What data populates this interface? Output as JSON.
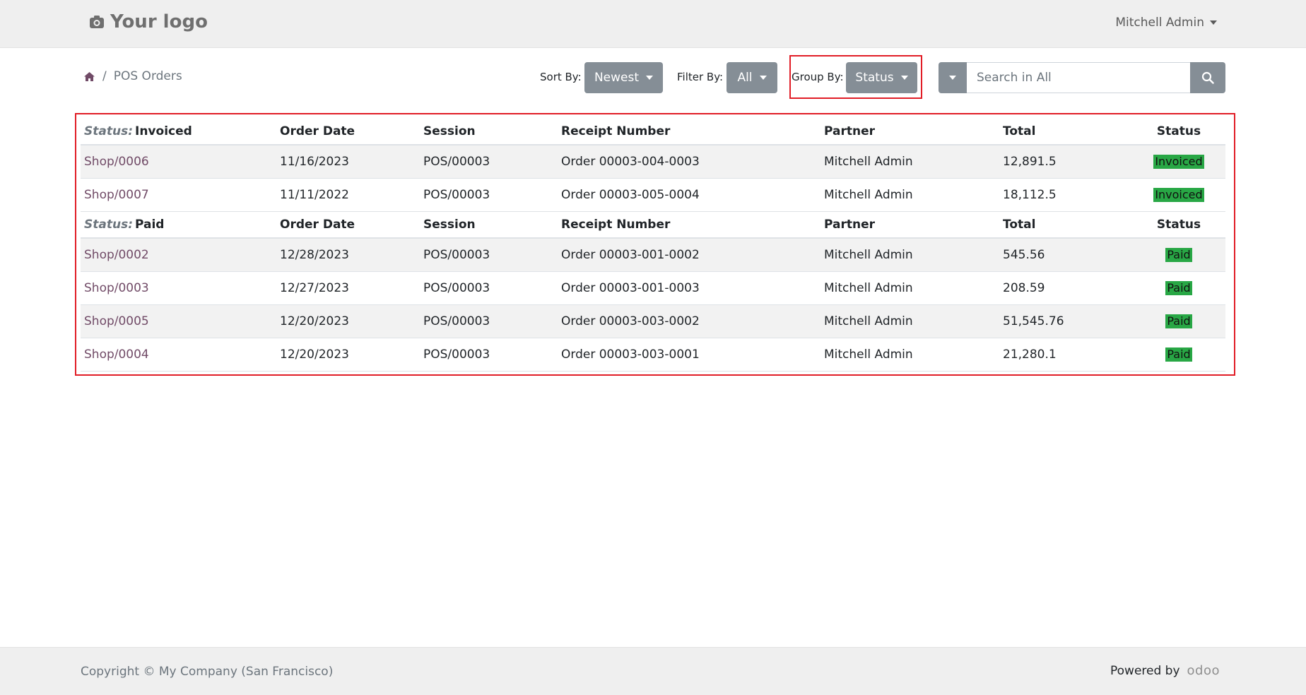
{
  "header": {
    "logo_text": "Your logo",
    "user_name": "Mitchell Admin"
  },
  "breadcrumb": {
    "current": "POS Orders"
  },
  "controls": {
    "sort_label": "Sort By:",
    "sort_value": "Newest",
    "filter_label": "Filter By:",
    "filter_value": "All",
    "group_label": "Group By:",
    "group_value": "Status",
    "search_placeholder": "Search in All"
  },
  "table": {
    "group_prefix": "Status:",
    "columns": [
      "Order Date",
      "Session",
      "Receipt Number",
      "Partner",
      "Total",
      "Status"
    ],
    "groups": [
      {
        "name": "Invoiced",
        "rows": [
          {
            "order": "Shop/0006",
            "date": "11/16/2023",
            "session": "POS/00003",
            "receipt": "Order 00003-004-0003",
            "partner": "Mitchell Admin",
            "total": "12,891.5",
            "status": "Invoiced"
          },
          {
            "order": "Shop/0007",
            "date": "11/11/2022",
            "session": "POS/00003",
            "receipt": "Order 00003-005-0004",
            "partner": "Mitchell Admin",
            "total": "18,112.5",
            "status": "Invoiced"
          }
        ]
      },
      {
        "name": "Paid",
        "rows": [
          {
            "order": "Shop/0002",
            "date": "12/28/2023",
            "session": "POS/00003",
            "receipt": "Order 00003-001-0002",
            "partner": "Mitchell Admin",
            "total": "545.56",
            "status": "Paid"
          },
          {
            "order": "Shop/0003",
            "date": "12/27/2023",
            "session": "POS/00003",
            "receipt": "Order 00003-001-0003",
            "partner": "Mitchell Admin",
            "total": "208.59",
            "status": "Paid"
          },
          {
            "order": "Shop/0005",
            "date": "12/20/2023",
            "session": "POS/00003",
            "receipt": "Order 00003-003-0002",
            "partner": "Mitchell Admin",
            "total": "51,545.76",
            "status": "Paid"
          },
          {
            "order": "Shop/0004",
            "date": "12/20/2023",
            "session": "POS/00003",
            "receipt": "Order 00003-003-0001",
            "partner": "Mitchell Admin",
            "total": "21,280.1",
            "status": "Paid"
          }
        ]
      }
    ]
  },
  "footer": {
    "copyright": "Copyright © My Company (San Francisco)",
    "powered_by": "Powered by",
    "brand": "odoo"
  },
  "colors": {
    "accent": "#714b67",
    "button_grey": "#858e96",
    "badge_green": "#28a745",
    "highlight_red": "#e11d26"
  }
}
